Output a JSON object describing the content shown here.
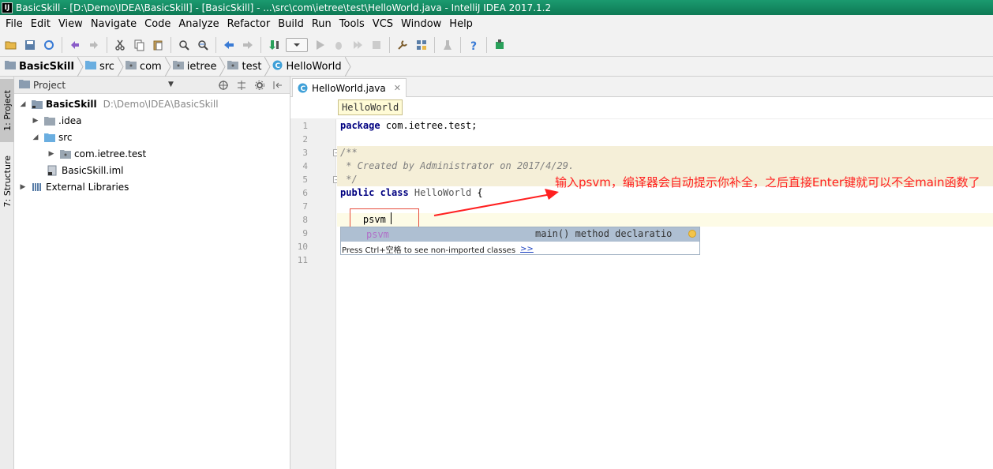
{
  "window": {
    "title": "BasicSkill - [D:\\Demo\\IDEA\\BasicSkill] - [BasicSkill] - ...\\src\\com\\ietree\\test\\HelloWorld.java - IntelliJ IDEA 2017.1.2"
  },
  "menu": [
    "File",
    "Edit",
    "View",
    "Navigate",
    "Code",
    "Analyze",
    "Refactor",
    "Build",
    "Run",
    "Tools",
    "VCS",
    "Window",
    "Help"
  ],
  "breadcrumb": [
    "BasicSkill",
    "src",
    "com",
    "ietree",
    "test",
    "HelloWorld"
  ],
  "left_strip": {
    "project_tab": "1: Project",
    "structure_tab": "7: Structure"
  },
  "project_panel": {
    "title": "Project",
    "tree": {
      "root": {
        "name": "BasicSkill",
        "path": "D:\\Demo\\IDEA\\BasicSkill"
      },
      "idea": ".idea",
      "src": "src",
      "package": "com.ietree.test",
      "iml": "BasicSkill.iml",
      "libraries": "External Libraries"
    }
  },
  "editor": {
    "tab_label": "HelloWorld.java",
    "breadcrumb_hint": "HelloWorld",
    "line_numbers": [
      "1",
      "2",
      "3",
      "4",
      "5",
      "6",
      "7",
      "8",
      "9",
      "10",
      "11"
    ],
    "code": {
      "line1_kw": "package",
      "line1_rest": " com.ietree.test;",
      "line3": "/**",
      "line4": " * Created by Administrator on 2017/4/29.",
      "line5": " */",
      "line6_kw": "public class",
      "line6_cls": " HelloWorld",
      "line6_rest": " {",
      "line8": "    psvm"
    },
    "autocomplete": {
      "item_name": "psvm",
      "item_desc": "main() method declaratio",
      "footer_text": "Press Ctrl+空格 to see non-imported classes",
      "footer_link": ">>"
    }
  },
  "annotation": {
    "text": "输入psvm，编译器会自动提示你补全，之后直接Enter键就可以不全main函数了",
    "color": "#ff2020"
  },
  "colors": {
    "titlebar": "#0e7a55",
    "comment_bg": "#f5efd8",
    "autocomplete_selected": "#aebfd2",
    "highlight_box": "#e74c3c"
  }
}
